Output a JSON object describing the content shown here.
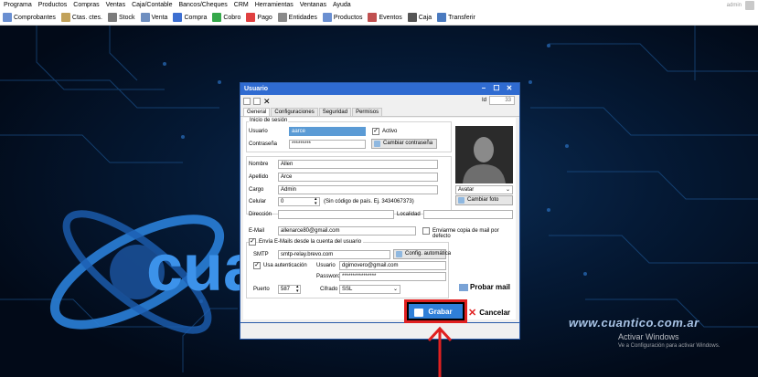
{
  "menu": [
    "Programa",
    "Productos",
    "Compras",
    "Ventas",
    "Caja/Contable",
    "Bancos/Cheques",
    "CRM",
    "Herramientas",
    "Ventanas",
    "Ayuda"
  ],
  "current_user": "admin",
  "toolbar": [
    {
      "label": "Comprobantes",
      "icon": "receipt-icon",
      "color": "#6a8fd1"
    },
    {
      "label": "Ctas. ctes.",
      "icon": "accounts-icon",
      "color": "#c2a25a"
    },
    {
      "label": "Stock",
      "icon": "stock-icon",
      "color": "#7c7c7c"
    },
    {
      "label": "Venta",
      "icon": "sale-icon",
      "color": "#6f8fc0"
    },
    {
      "label": "Compra",
      "icon": "cart-icon",
      "color": "#3d6fd1"
    },
    {
      "label": "Cobro",
      "icon": "dollar-in-icon",
      "color": "#35a84a"
    },
    {
      "label": "Pago",
      "icon": "dollar-out-icon",
      "color": "#e04040"
    },
    {
      "label": "Entidades",
      "icon": "entities-icon",
      "color": "#8a8a8a"
    },
    {
      "label": "Productos",
      "icon": "products-icon",
      "color": "#6a8fd1"
    },
    {
      "label": "Eventos",
      "icon": "events-icon",
      "color": "#c05050"
    },
    {
      "label": "Caja",
      "icon": "cashbox-icon",
      "color": "#555555"
    },
    {
      "label": "Transferir",
      "icon": "transfer-icon",
      "color": "#4a7abf"
    }
  ],
  "dialog": {
    "title": "Usuario",
    "id_label": "Id",
    "id_value": "33",
    "tabs": [
      "General",
      "Configuraciones",
      "Seguridad",
      "Permisos"
    ],
    "active_tab": "General",
    "session_group": "Inicio de sesión",
    "usuario_label": "Usuario",
    "usuario_value": "aarce",
    "activo_label": "Activo",
    "contrasena_label": "Contraseña",
    "contrasena_value": "*********",
    "cambiar_contrasena": "Cambiar contraseña",
    "nombre_label": "Nombre",
    "nombre_value": "Allen",
    "apellido_label": "Apellido",
    "apellido_value": "Arce",
    "cargo_label": "Cargo",
    "cargo_value": "Admin",
    "celular_label": "Celular",
    "celular_value": "0",
    "celular_hint": "(Sin código de país. Ej. 3434067373)",
    "direccion_label": "Dirección",
    "localidad_label": "Localidad",
    "avatar_select": "Avatar",
    "cambiar_foto": "Cambiar foto",
    "email_label": "E-Mail",
    "email_value": "allenarce80@gmail.com",
    "copia_label": "Enviarme copia de mail por defecto",
    "envia_label": "Envía E-Mails desde la cuenta del usuario",
    "smtp_label": "SMTP",
    "smtp_value": "smtp-relay.brevo.com",
    "config_auto": "Config. automática",
    "usa_auth_label": "Usa autenticación",
    "auth_usuario_label": "Usuario",
    "auth_usuario_value": "dgimovero@gmail.com",
    "password_label": "Password",
    "password_value": "****************",
    "puerto_label": "Puerto",
    "puerto_value": "587",
    "cifrado_label": "Cifrado",
    "cifrado_value": "SSL",
    "probar_mail": "Probar mail",
    "grabar": "Grabar",
    "cancelar": "Cancelar"
  },
  "watermark": "www.cuantico.com.ar",
  "logo_text": "cua",
  "activation_title": "Activar Windows",
  "activation_sub": "Ve a Configuración para activar Windows."
}
